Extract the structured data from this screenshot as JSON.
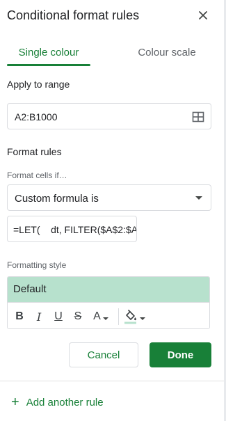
{
  "panel": {
    "title": "Conditional format rules"
  },
  "tabs": [
    {
      "label": "Single colour",
      "active": true
    },
    {
      "label": "Colour scale",
      "active": false
    }
  ],
  "apply_range": {
    "label": "Apply to range",
    "value": "A2:B1000"
  },
  "format_rules": {
    "label": "Format rules",
    "condition_label": "Format cells if…",
    "condition_value": "Custom formula is",
    "formula_value": "=LET(    dt, FILTER($A$2:$A"
  },
  "formatting_style": {
    "label": "Formatting style",
    "preview_text": "Default",
    "preview_color": "#b7e1cd",
    "toolbar": {
      "bold": "B",
      "italic": "I",
      "underline": "U",
      "strikethrough": "S",
      "text_color": "A"
    }
  },
  "buttons": {
    "cancel": "Cancel",
    "done": "Done"
  },
  "add_rule": {
    "plus": "+",
    "label": "Add another rule"
  },
  "colors": {
    "accent": "#188038",
    "fill_underline": "#b7e1cd"
  }
}
